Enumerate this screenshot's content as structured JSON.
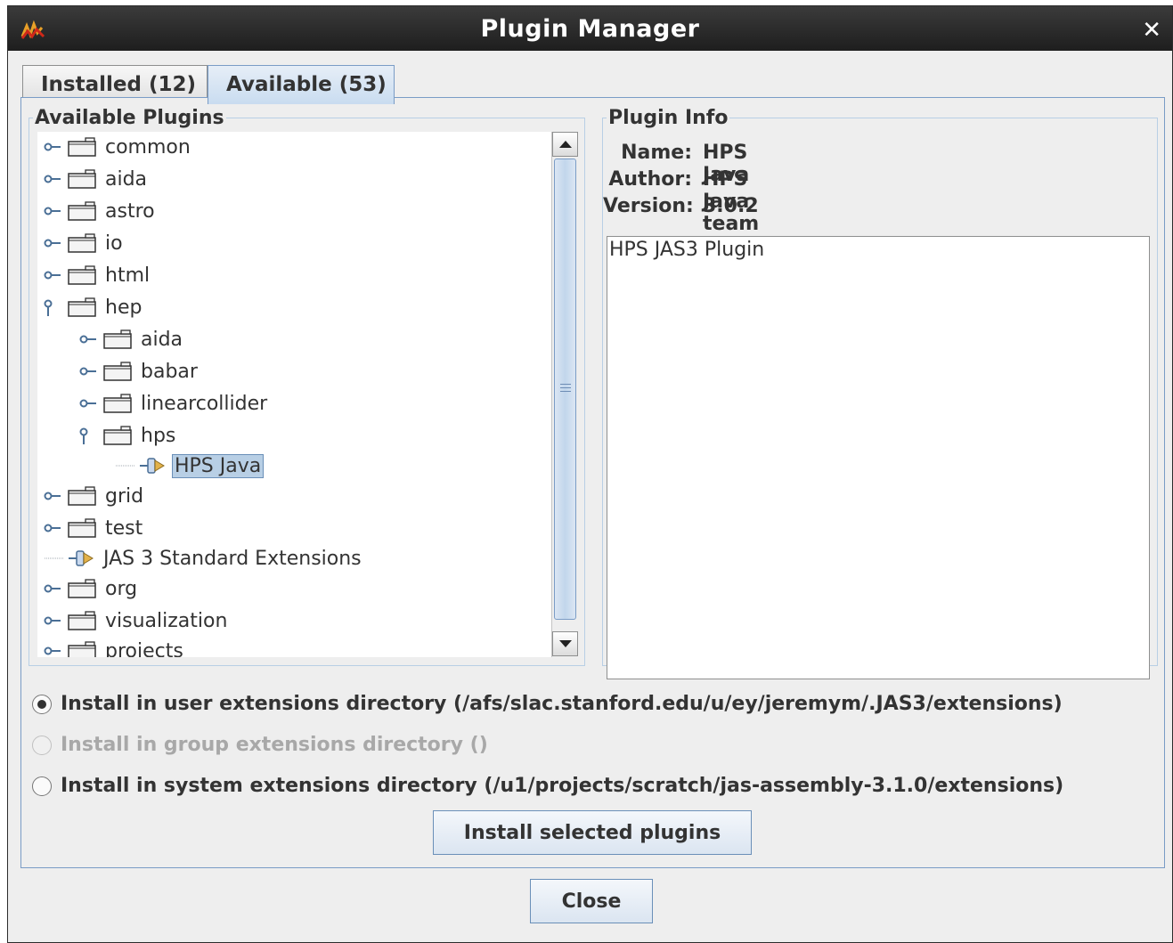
{
  "window": {
    "title": "Plugin Manager",
    "close_symbol": "✕"
  },
  "tabs": [
    {
      "label": "Installed (12)",
      "selected": false
    },
    {
      "label": "Available (53)",
      "selected": true
    }
  ],
  "available_plugins": {
    "legend": "Available Plugins",
    "tree": [
      {
        "label": "common",
        "type": "folder",
        "expanded": false,
        "level": 0
      },
      {
        "label": "aida",
        "type": "folder",
        "expanded": false,
        "level": 0
      },
      {
        "label": "astro",
        "type": "folder",
        "expanded": false,
        "level": 0
      },
      {
        "label": "io",
        "type": "folder",
        "expanded": false,
        "level": 0
      },
      {
        "label": "html",
        "type": "folder",
        "expanded": false,
        "level": 0
      },
      {
        "label": "hep",
        "type": "folder",
        "expanded": true,
        "level": 0
      },
      {
        "label": "aida",
        "type": "folder",
        "expanded": false,
        "level": 1
      },
      {
        "label": "babar",
        "type": "folder",
        "expanded": false,
        "level": 1
      },
      {
        "label": "linearcollider",
        "type": "folder",
        "expanded": false,
        "level": 1
      },
      {
        "label": "hps",
        "type": "folder",
        "expanded": true,
        "level": 1
      },
      {
        "label": "HPS Java",
        "type": "plugin",
        "level": 2,
        "selected": true
      },
      {
        "label": "grid",
        "type": "folder",
        "expanded": false,
        "level": 0
      },
      {
        "label": "test",
        "type": "folder",
        "expanded": false,
        "level": 0
      },
      {
        "label": "JAS 3 Standard Extensions",
        "type": "plugin",
        "level": 0
      },
      {
        "label": "org",
        "type": "folder",
        "expanded": false,
        "level": 0
      },
      {
        "label": "visualization",
        "type": "folder",
        "expanded": false,
        "level": 0
      },
      {
        "label": "projects",
        "type": "folder",
        "expanded": false,
        "level": 0
      }
    ]
  },
  "plugin_info": {
    "legend": "Plugin Info",
    "name_label": "Name:",
    "name": "HPS Java",
    "author_label": "Author:",
    "author": "HPS Java team",
    "version_label": "Version:",
    "version": "3.0.2",
    "description": "HPS JAS3 Plugin"
  },
  "install_options": [
    {
      "label": "Install in user extensions directory (/afs/slac.stanford.edu/u/ey/jeremym/.JAS3/extensions)",
      "selected": true,
      "enabled": true
    },
    {
      "label": "Install in group extensions directory ()",
      "selected": false,
      "enabled": false
    },
    {
      "label": "Install in system extensions directory (/u1/projects/scratch/jas-assembly-3.1.0/extensions)",
      "selected": false,
      "enabled": true
    }
  ],
  "buttons": {
    "install": "Install selected plugins",
    "close": "Close"
  },
  "icons": {
    "app": "jas3-app-icon",
    "folder": "folder-icon",
    "plugin": "plugin-icon",
    "expand": "expand-handle-icon"
  },
  "colors": {
    "selection": "#b8cfe5",
    "accent_border": "#7a9cc6",
    "titlebar": "#2a2a2a"
  }
}
